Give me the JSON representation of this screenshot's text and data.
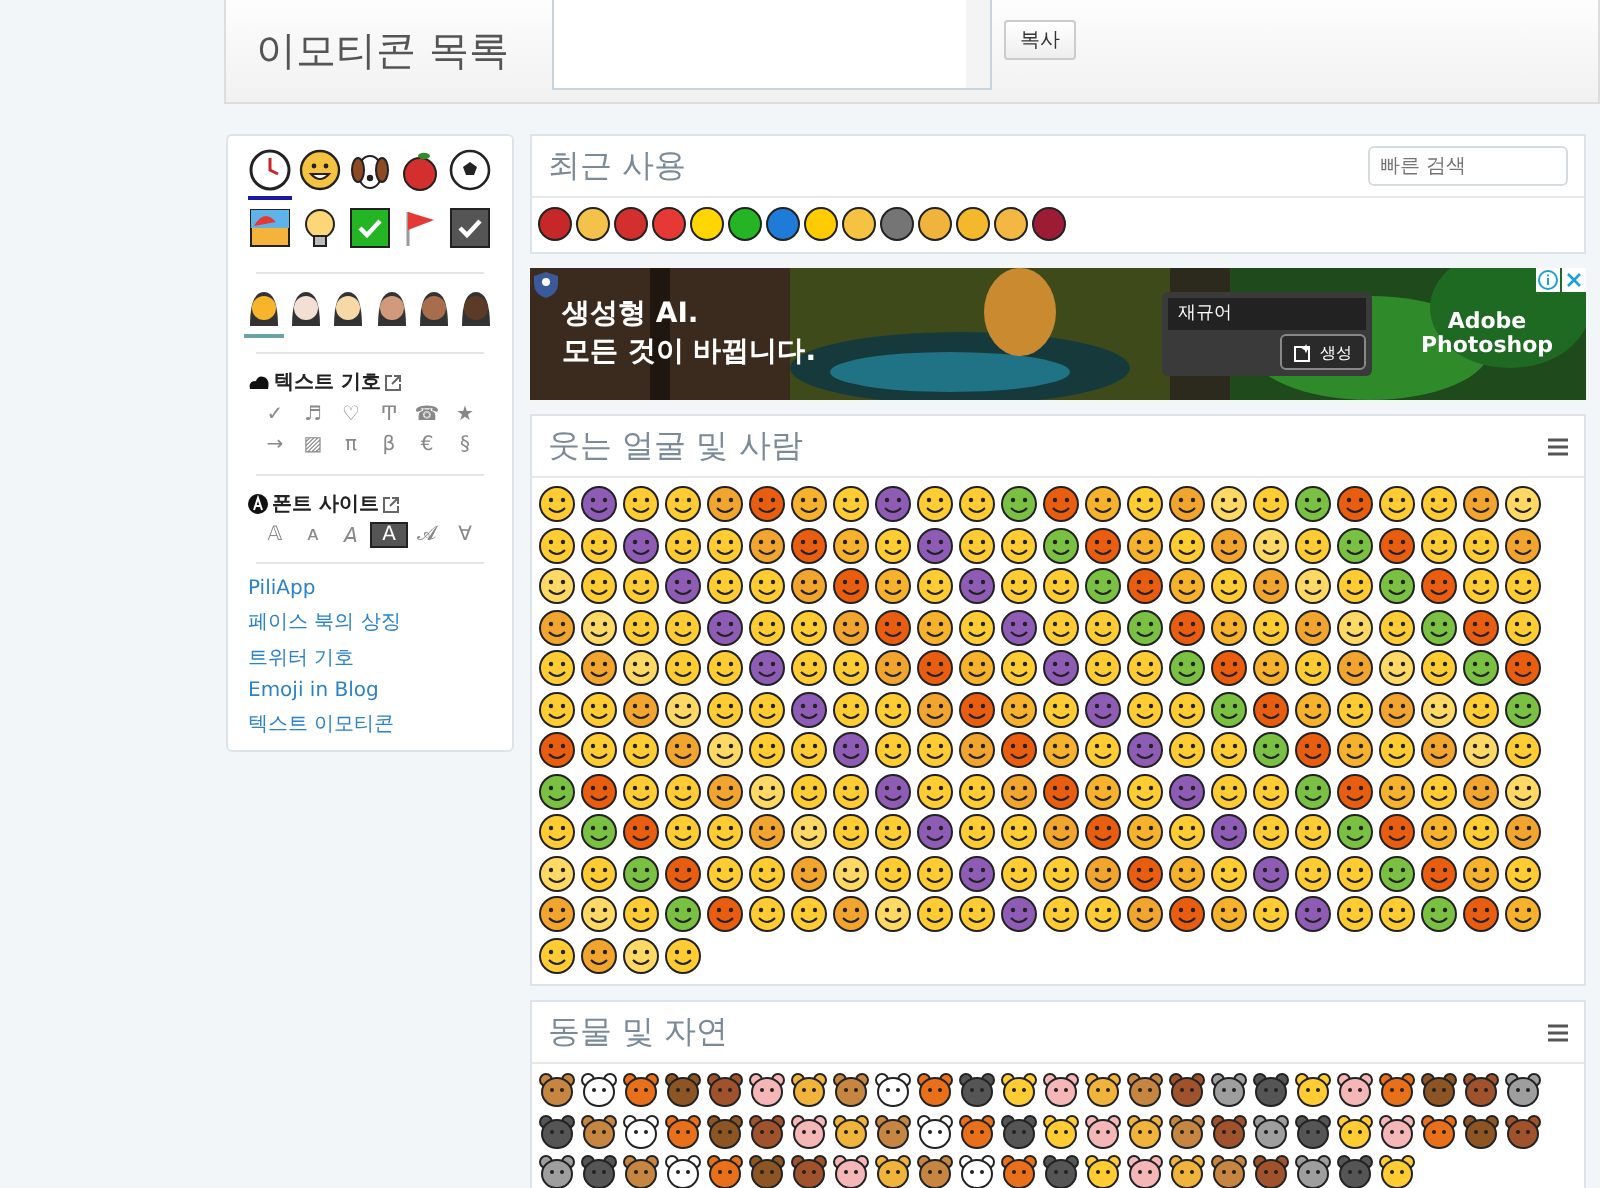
{
  "header": {
    "title": "이모티콘 목록",
    "copy_button": "복사"
  },
  "sidebar": {
    "categories": [
      {
        "kind": "clock",
        "selected": true
      },
      {
        "kind": "smiley",
        "selected": false
      },
      {
        "kind": "dog",
        "selected": false
      },
      {
        "kind": "apple",
        "selected": false
      },
      {
        "kind": "ball",
        "selected": false
      },
      {
        "kind": "beach",
        "selected": false
      },
      {
        "kind": "bulb",
        "selected": false
      },
      {
        "kind": "check",
        "selected": false
      },
      {
        "kind": "flag",
        "selected": false
      },
      {
        "kind": "checkbox",
        "selected": false
      }
    ],
    "skin_tones": [
      {
        "color": "#f7b52c",
        "selected": true
      },
      {
        "color": "#f3dfd3",
        "selected": false
      },
      {
        "color": "#f6d9a6",
        "selected": false
      },
      {
        "color": "#d19a7a",
        "selected": false
      },
      {
        "color": "#a86d4a",
        "selected": false
      },
      {
        "color": "#5c3a28",
        "selected": false
      }
    ],
    "text_symbols": {
      "title": "텍스트 기호",
      "symbols": [
        "✓",
        "♬",
        "♡",
        "Ͳ",
        "☎",
        "★",
        "→",
        "▨",
        "π",
        "β",
        "€",
        "§"
      ]
    },
    "font_site": {
      "title": "폰트 사이트",
      "samples": [
        {
          "text": "𝔸",
          "kind": "plain"
        },
        {
          "text": "ᴀ",
          "kind": "plain"
        },
        {
          "text": "𝘈",
          "kind": "plain"
        },
        {
          "text": "A",
          "kind": "boxed"
        },
        {
          "text": "𝓐",
          "kind": "plain"
        },
        {
          "text": "∀",
          "kind": "plain"
        }
      ]
    },
    "links": [
      "PiliApp",
      "페이스 북의 상징",
      "트위터 기호",
      "Emoji in Blog",
      "텍스트 이모티콘"
    ]
  },
  "recent": {
    "title": "최근 사용",
    "search_placeholder": "빠른 검색"
  },
  "ad": {
    "headline": [
      "생성형 AI.",
      "모든 것이 바뀝니다."
    ],
    "prompt": "재규어",
    "generate_button": "생성",
    "brand": "Adobe Photoshop"
  },
  "sections": [
    {
      "title": "웃는 얼굴 및 사람",
      "kind": "faces"
    },
    {
      "title": "동물 및 자연",
      "kind": "animals"
    }
  ]
}
